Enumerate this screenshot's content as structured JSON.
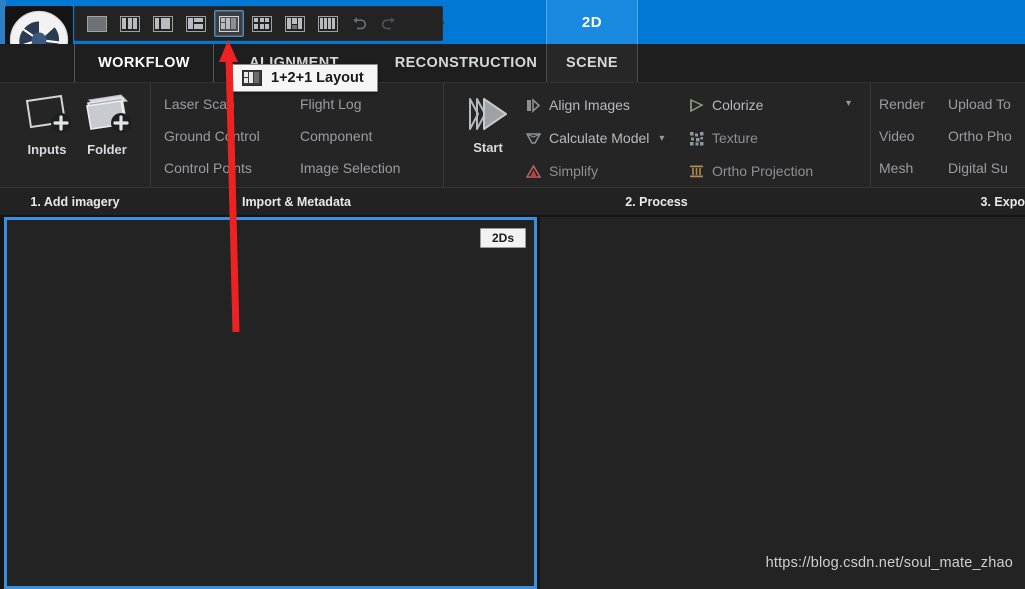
{
  "app": {
    "logo_icon": "aperture-logo-icon",
    "accent_blue": "#0078d4",
    "selection_blue": "#3b8ee0",
    "panel_bg": "#252526"
  },
  "titlebar": {
    "active_view_tab": "2D",
    "quick_access_dropdown_icon": "chevron-down-icon"
  },
  "layout_toolbar": {
    "buttons": [
      {
        "name": "single-layout",
        "icon": "layout-1-icon",
        "selected": false
      },
      {
        "name": "three-columns-layout",
        "icon": "layout-3col-icon",
        "selected": false
      },
      {
        "name": "one-plus-one-layout",
        "icon": "layout-1plus1-icon",
        "selected": false
      },
      {
        "name": "one-plus-two-layout",
        "icon": "layout-1plus2-icon",
        "selected": false
      },
      {
        "name": "one-plus-two-plus-one-layout",
        "icon": "layout-1plus2plus1-icon",
        "selected": true
      },
      {
        "name": "two-by-two-layout",
        "icon": "layout-2x2-icon",
        "selected": false
      },
      {
        "name": "three-plus-one-layout",
        "icon": "layout-3plus1-icon",
        "selected": false
      },
      {
        "name": "grid-layout",
        "icon": "layout-grid-icon",
        "selected": false
      }
    ],
    "undo_icon": "undo-icon",
    "redo_icon": "redo-icon"
  },
  "tooltip": {
    "text": "1+2+1 Layout",
    "icon": "layout-1plus2plus1-icon"
  },
  "tabs": [
    {
      "label": "WORKFLOW",
      "active": true
    },
    {
      "label": "ALIGNMENT",
      "active": false
    },
    {
      "label": "RECONSTRUCTION",
      "active": false
    },
    {
      "label": "SCENE",
      "active": false
    }
  ],
  "ribbon": {
    "panels": [
      {
        "caption": "1. Add imagery",
        "big_buttons": [
          {
            "label": "Inputs",
            "icon": "add-image-icon"
          },
          {
            "label": "Folder",
            "icon": "add-folder-icon"
          }
        ]
      },
      {
        "caption": "Import & Metadata",
        "items": [
          {
            "label": "Laser Scan"
          },
          {
            "label": "Flight Log"
          },
          {
            "label": "Ground Control"
          },
          {
            "label": "Component"
          },
          {
            "label": "Control Points"
          },
          {
            "label": "Image Selection"
          }
        ]
      },
      {
        "caption": "2. Process",
        "big_buttons": [
          {
            "label": "Start",
            "icon": "play-start-icon"
          }
        ],
        "items": [
          {
            "label": "Align Images",
            "icon": "align-images-icon",
            "caret": false
          },
          {
            "label": "Calculate Model",
            "icon": "calculate-model-icon",
            "caret": true
          },
          {
            "label": "Simplify",
            "icon": "simplify-icon",
            "caret": false
          },
          {
            "label": "Colorize",
            "icon": "colorize-icon",
            "caret": true
          },
          {
            "label": "Texture",
            "icon": "texture-icon",
            "caret": false
          },
          {
            "label": "Ortho Projection",
            "icon": "ortho-projection-icon",
            "caret": false
          }
        ]
      },
      {
        "caption": "3. Expo",
        "items": [
          {
            "label": "Render"
          },
          {
            "label": "Upload To"
          },
          {
            "label": "Video"
          },
          {
            "label": "Ortho Pho"
          },
          {
            "label": "Mesh"
          },
          {
            "label": "Digital Su"
          }
        ]
      }
    ]
  },
  "viewports": {
    "left": {
      "tag": "2Ds",
      "active": true
    },
    "right": {
      "tag": "",
      "active": false
    }
  },
  "watermark": "https://blog.csdn.net/soul_mate_zhao"
}
